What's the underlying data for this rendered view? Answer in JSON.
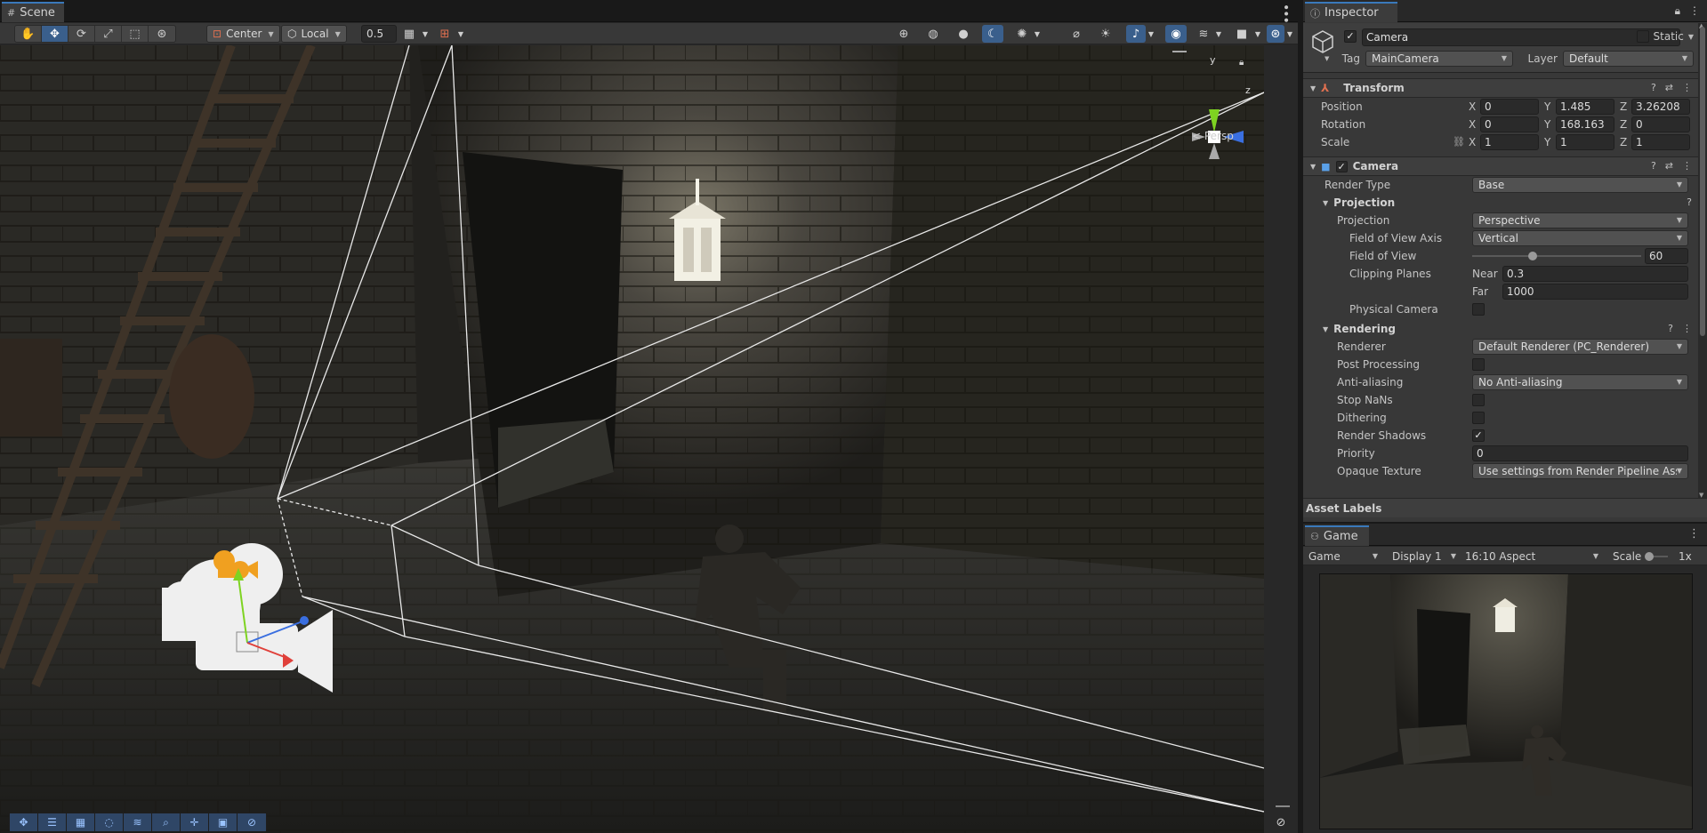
{
  "scene": {
    "tab_label": "Scene",
    "toolbar": {
      "pivot_mode": "Center",
      "pivot_rotation": "Local",
      "grid_snap": "0.5"
    },
    "orientation_gizmo": {
      "y_label": "y",
      "z_label": "z",
      "projection_label": "< Persp"
    }
  },
  "inspector": {
    "tab_label": "Inspector",
    "object": {
      "active": true,
      "name": "Camera",
      "static_label": "Static",
      "static": false,
      "tag_label": "Tag",
      "tag_value": "MainCamera",
      "layer_label": "Layer",
      "layer_value": "Default"
    },
    "transform": {
      "title": "Transform",
      "position_label": "Position",
      "rotation_label": "Rotation",
      "scale_label": "Scale",
      "position": {
        "x": "0",
        "y": "1.485",
        "z": "3.26208"
      },
      "rotation": {
        "x": "0",
        "y": "168.163",
        "z": "0"
      },
      "scale": {
        "x": "1",
        "y": "1",
        "z": "1"
      },
      "axis_x": "X",
      "axis_y": "Y",
      "axis_z": "Z"
    },
    "camera": {
      "title": "Camera",
      "enabled": true,
      "render_type_label": "Render Type",
      "render_type": "Base",
      "projection_section": "Projection",
      "projection_label": "Projection",
      "projection_value": "Perspective",
      "fov_axis_label": "Field of View Axis",
      "fov_axis_value": "Vertical",
      "fov_label": "Field of View",
      "fov_value": "60",
      "fov_slider_fraction": 0.35,
      "clipping_label": "Clipping Planes",
      "near_label": "Near",
      "near_value": "0.3",
      "far_label": "Far",
      "far_value": "1000",
      "physical_camera_label": "Physical Camera",
      "physical_camera": false,
      "rendering_section": "Rendering",
      "renderer_label": "Renderer",
      "renderer_value": "Default Renderer (PC_Renderer)",
      "post_processing_label": "Post Processing",
      "post_processing": false,
      "anti_aliasing_label": "Anti-aliasing",
      "anti_aliasing_value": "No Anti-aliasing",
      "stop_nans_label": "Stop NaNs",
      "stop_nans": false,
      "dithering_label": "Dithering",
      "dithering": false,
      "render_shadows_label": "Render Shadows",
      "render_shadows": true,
      "priority_label": "Priority",
      "priority_value": "0",
      "opaque_texture_label": "Opaque Texture",
      "opaque_texture_value": "Use settings from Render Pipeline Asset"
    },
    "asset_labels": "Asset Labels"
  },
  "game": {
    "tab_label": "Game",
    "mode": "Game",
    "display": "Display 1",
    "aspect": "16:10 Aspect",
    "scale_label": "Scale",
    "scale_value": "1x"
  },
  "colors": {
    "accent": "#3a79bb",
    "active_tool": "#3a5f8c",
    "panel_bg": "#383838",
    "field_bg": "#2a2a2a",
    "gizmo_x": "#e0403a",
    "gizmo_y": "#7ed321",
    "gizmo_z": "#3a6fe0",
    "camera_icon": "#f0a020"
  }
}
